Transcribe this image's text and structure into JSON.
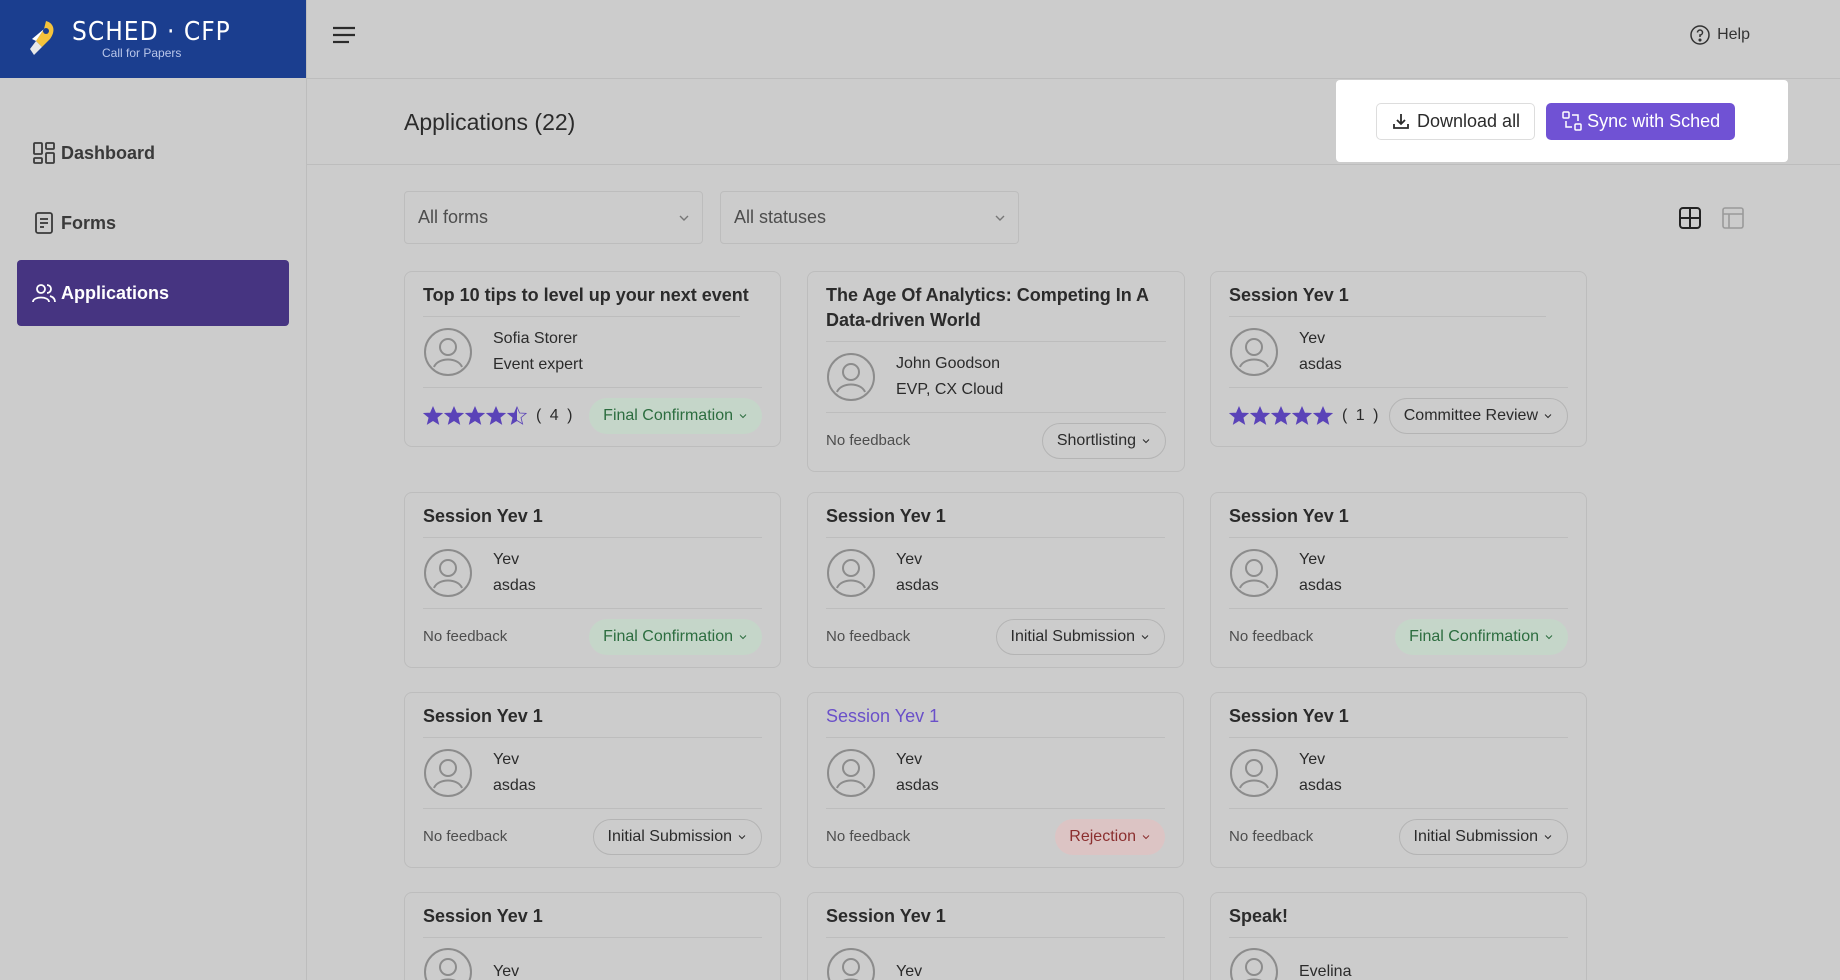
{
  "brand": {
    "title": "SCHED · CFP",
    "subtitle": "Call for Papers"
  },
  "nav": [
    {
      "label": "Dashboard",
      "icon": "dashboard-icon",
      "active": false
    },
    {
      "label": "Forms",
      "icon": "forms-icon",
      "active": false
    },
    {
      "label": "Applications",
      "icon": "users-icon",
      "active": true
    }
  ],
  "topbar": {
    "help_label": "Help"
  },
  "header": {
    "title": "Applications (22)",
    "download_label": "Download all",
    "sync_label": "Sync with Sched"
  },
  "filters": {
    "form": "All forms",
    "status": "All statuses"
  },
  "colors": {
    "brand": "#1b3e8f",
    "accent": "#7052d4",
    "nav_active": "#463481",
    "star": "#5a43b8"
  },
  "cards": [
    {
      "title": "Top 10 tips to level up your next event",
      "name": "Sofia Storer",
      "role": "Event expert",
      "rating": 4.5,
      "rating_count": "( 4 )",
      "status": "Final Confirmation",
      "status_tone": "green"
    },
    {
      "title": "The Age Of Analytics: Competing In A Data-driven World",
      "name": "John Goodson",
      "role": "EVP, CX Cloud",
      "feedback": "No feedback",
      "status": "Shortlisting",
      "status_tone": "neutral"
    },
    {
      "title": "Session Yev 1",
      "name": "Yev",
      "role": "asdas",
      "rating": 5,
      "rating_count": "( 1 )",
      "status": "Committee Review",
      "status_tone": "neutral"
    },
    {
      "title": "Session Yev 1",
      "name": "Yev",
      "role": "asdas",
      "feedback": "No feedback",
      "status": "Final Confirmation",
      "status_tone": "green"
    },
    {
      "title": "Session Yev 1",
      "name": "Yev",
      "role": "asdas",
      "feedback": "No feedback",
      "status": "Initial Submission",
      "status_tone": "neutral"
    },
    {
      "title": "Session Yev 1",
      "name": "Yev",
      "role": "asdas",
      "feedback": "No feedback",
      "status": "Final Confirmation",
      "status_tone": "green"
    },
    {
      "title": "Session Yev 1",
      "name": "Yev",
      "role": "asdas",
      "feedback": "No feedback",
      "status": "Initial Submission",
      "status_tone": "neutral"
    },
    {
      "title": "Session Yev 1",
      "name": "Yev",
      "role": "asdas",
      "feedback": "No feedback",
      "status": "Rejection",
      "status_tone": "red",
      "highlight": true
    },
    {
      "title": "Session Yev 1",
      "name": "Yev",
      "role": "asdas",
      "feedback": "No feedback",
      "status": "Initial Submission",
      "status_tone": "neutral"
    },
    {
      "title": "Session Yev 1",
      "name": "Yev",
      "role": ""
    },
    {
      "title": "Session Yev 1",
      "name": "Yev",
      "role": ""
    },
    {
      "title": "Speak!",
      "name": "Evelina",
      "role": ""
    }
  ]
}
